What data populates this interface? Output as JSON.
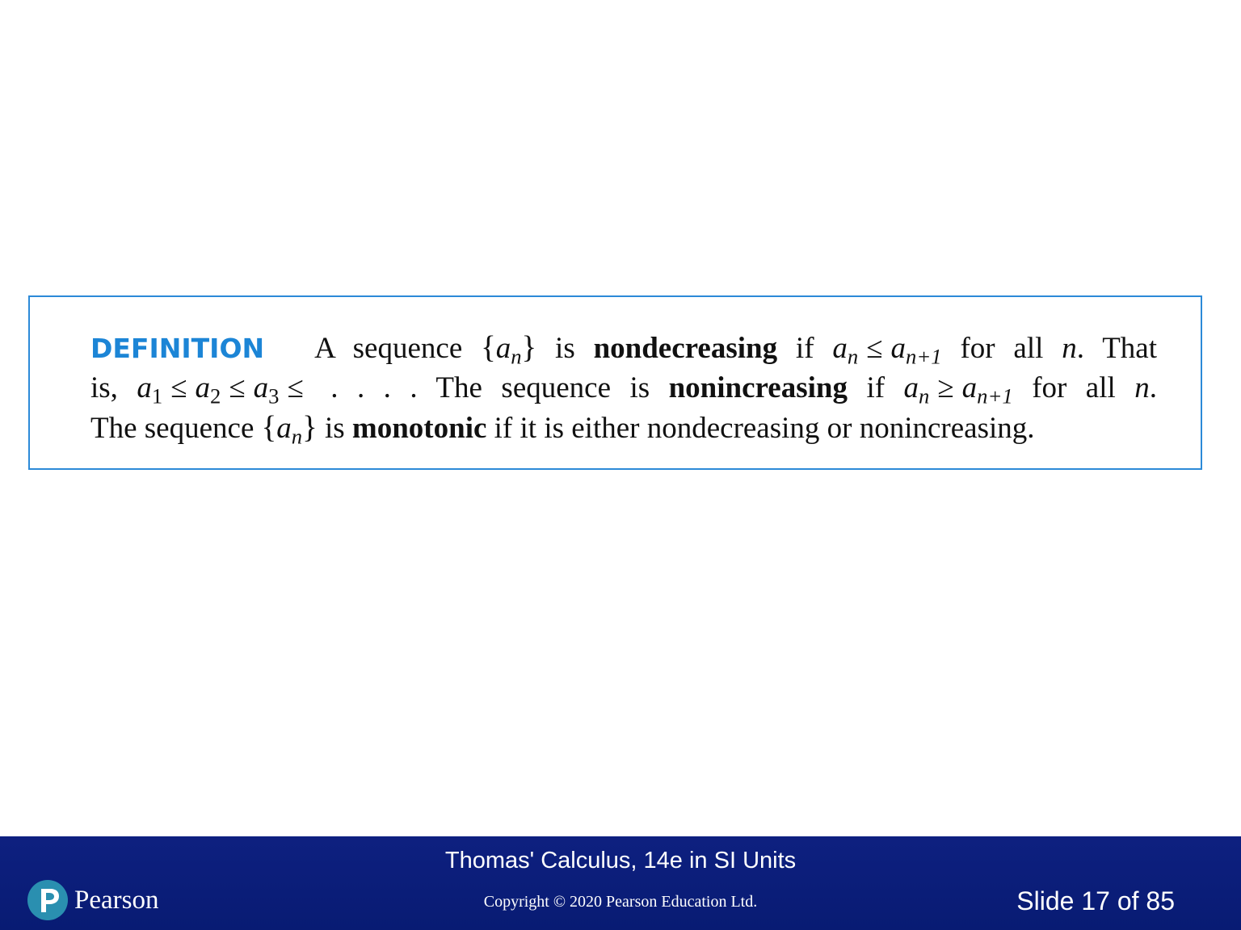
{
  "slide": {
    "definition": {
      "label": "DEFINITION",
      "line1": {
        "t1": "A sequence ",
        "brace_open": "{",
        "a": "a",
        "sub_n": "n",
        "brace_close": "}",
        "t2": " is ",
        "bold1": "nondecreasing",
        "t3": " if ",
        "a2": "a",
        "sub_n2": "n",
        "le": "≤",
        "a3": "a",
        "sub_n1": "n+1",
        "t4": " for all ",
        "n": "n",
        "t5": ". That"
      },
      "line2": {
        "t1": "is, ",
        "a1": "a",
        "s1": "1",
        "le1": "≤",
        "a2": "a",
        "s2": "2",
        "le2": "≤",
        "a3": "a",
        "s3": "3",
        "le3": "≤",
        "t2": " . . . . The sequence is ",
        "bold2": "nonincreasing",
        "t3": " if ",
        "a4": "a",
        "s4": "n",
        "ge": "≥",
        "a5": "a",
        "s5": "n+1",
        "t4": " for all ",
        "n": "n",
        "t5": "."
      },
      "line3": {
        "t1": "The sequence ",
        "brace_open": "{",
        "a": "a",
        "sub_n": "n",
        "brace_close": "}",
        "t2": " is ",
        "bold3": "monotonic",
        "t3": " if it is either nondecreasing or nonincreasing."
      }
    }
  },
  "footer": {
    "title": "Thomas' Calculus, 14e in SI Units",
    "copyright": "Copyright © 2020 Pearson Education Ltd.",
    "slide_number": "Slide 17 of 85",
    "logo_text": "Pearson"
  },
  "colors": {
    "accent_blue": "#1c85d6",
    "box_border": "#2c8ad8",
    "footer_bg": "#0a1f7a",
    "logo_circle": "#2a8fb0"
  }
}
